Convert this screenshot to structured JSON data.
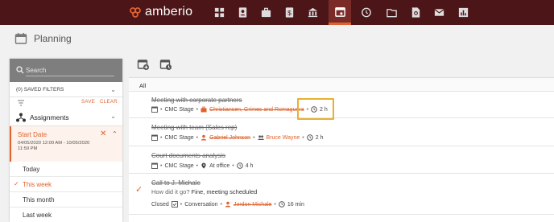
{
  "app": {
    "logo_text": "amberio"
  },
  "page": {
    "title": "Planning"
  },
  "search": {
    "placeholder": "Search"
  },
  "filters": {
    "saved_label": "(0) SAVED FILTERS",
    "save_label": "SAVE",
    "clear_label": "CLEAR",
    "assignments_label": "Assignments",
    "start_date": {
      "label": "Start Date",
      "range": "04/05/2020 12:00 AM - 10/05/2020 11:59 PM"
    },
    "options": [
      {
        "label": "Today",
        "selected": false
      },
      {
        "label": "This week",
        "selected": true
      },
      {
        "label": "This month",
        "selected": false
      },
      {
        "label": "Last week",
        "selected": false
      }
    ]
  },
  "list": {
    "group_label": "All",
    "items": [
      {
        "title": "Meeting with corporate partners",
        "stage": "CMC Stage",
        "client": "Christiansen, Grimes and Romaguera",
        "duration": "2 h"
      },
      {
        "title": "Meeting with team (Sales rep)",
        "stage": "CMC Stage",
        "person": "Gabriel Johnson",
        "group": "Bruce Wayne",
        "duration": "2 h"
      },
      {
        "title": "Court documents analysis",
        "stage": "CMC Stage",
        "location": "At office",
        "duration": "4 h"
      },
      {
        "title": "Call to J. Michale",
        "subtitle_question": "How did it go?",
        "subtitle_answer": "Fine, meeting scheduled",
        "status": "Closed",
        "type": "Conversation",
        "person": "Jordon Michale",
        "duration": "16 min"
      }
    ]
  },
  "colors": {
    "topbar": "#4c1517",
    "accent": "#e0622c",
    "highlight": "#e8b030"
  }
}
